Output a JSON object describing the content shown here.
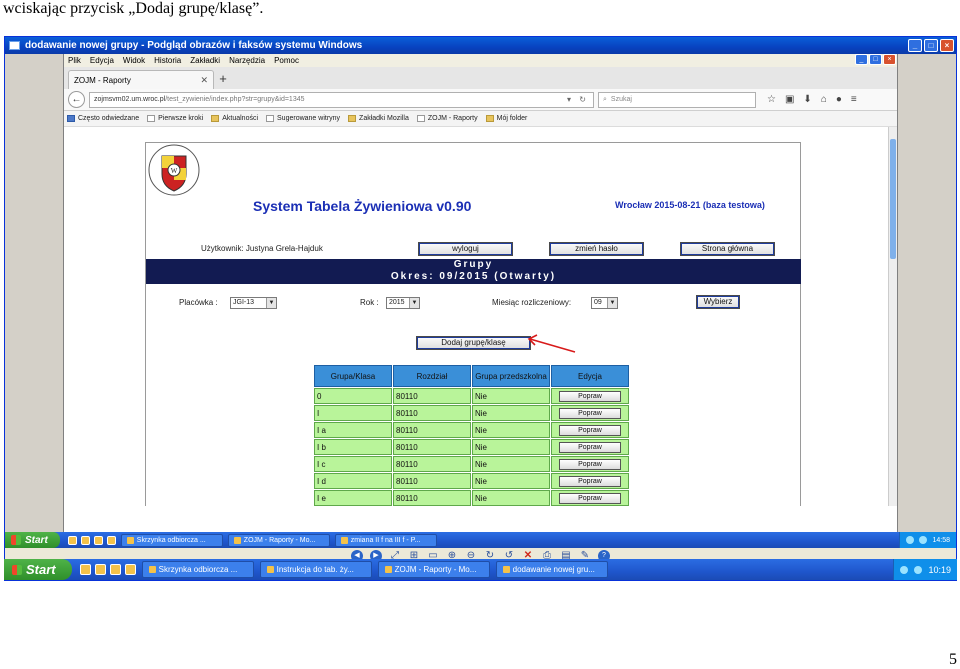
{
  "doc": {
    "heading": "wciskając przycisk „Dodaj grupę/klasę”.",
    "page_number": "5"
  },
  "outer_window": {
    "title": "dodawanie nowej grupy - Podgląd obrazów i faksów systemu Windows"
  },
  "browser": {
    "menu": [
      "Plik",
      "Edycja",
      "Widok",
      "Historia",
      "Zakładki",
      "Narzędzia",
      "Pomoc"
    ],
    "tab_title": "ZOJM - Raporty",
    "url_prefix": "zojmsvm02.um.wroc.pl",
    "url_path": "/test_zywienie/index.php?str=grupy&id=1345",
    "search_placeholder": "Szukaj",
    "bookmarks": [
      "Często odwiedzane",
      "Pierwsze kroki",
      "Aktualności",
      "Sugerowane witryny",
      "Zakładki Mozilla",
      "ZOJM - Raporty",
      "Mój folder"
    ]
  },
  "app": {
    "title": "System Tabela Żywieniowa v0.90",
    "date_info": "Wrocław 2015-08-21 (baza testowa)",
    "user_label": "Użytkownik: Justyna Grela-Hajduk",
    "btn_logout": "wyloguj",
    "btn_change_password": "zmień hasło",
    "btn_home": "Strona główna",
    "section_title": "Grupy",
    "period": "Okres: 09/2015 (Otwarty)",
    "label_placowka": "Placówka :",
    "placowka_value": "JGI-13",
    "label_rok": "Rok :",
    "rok_value": "2015",
    "label_miesiac": "Miesiąc rozliczeniowy:",
    "miesiac_value": "09",
    "btn_select": "Wybierz",
    "btn_add_group": "Dodaj grupę/klasę",
    "table": {
      "headers": [
        "Grupa/Klasa",
        "Rozdział",
        "Grupa przedszkolna",
        "Edycja"
      ],
      "rows": [
        [
          "0",
          "80110",
          "Nie",
          "Popraw"
        ],
        [
          "I",
          "80110",
          "Nie",
          "Popraw"
        ],
        [
          "I a",
          "80110",
          "Nie",
          "Popraw"
        ],
        [
          "I b",
          "80110",
          "Nie",
          "Popraw"
        ],
        [
          "I c",
          "80110",
          "Nie",
          "Popraw"
        ],
        [
          "I d",
          "80110",
          "Nie",
          "Popraw"
        ],
        [
          "I e",
          "80110",
          "Nie",
          "Popraw"
        ]
      ]
    }
  },
  "inner_taskbar": {
    "start": "Start",
    "tasks": [
      "Skrzynka odbiorcza ...",
      "ZOJM - Raporty - Mo...",
      "zmiana II f na III f - P..."
    ],
    "time": "14:58"
  },
  "outer_taskbar": {
    "start": "Start",
    "tasks": [
      "Skrzynka odbiorcza ...",
      "Instrukcja do tab. ży...",
      "ZOJM - Raporty - Mo...",
      "dodawanie nowej gru..."
    ],
    "time": "10:19"
  }
}
